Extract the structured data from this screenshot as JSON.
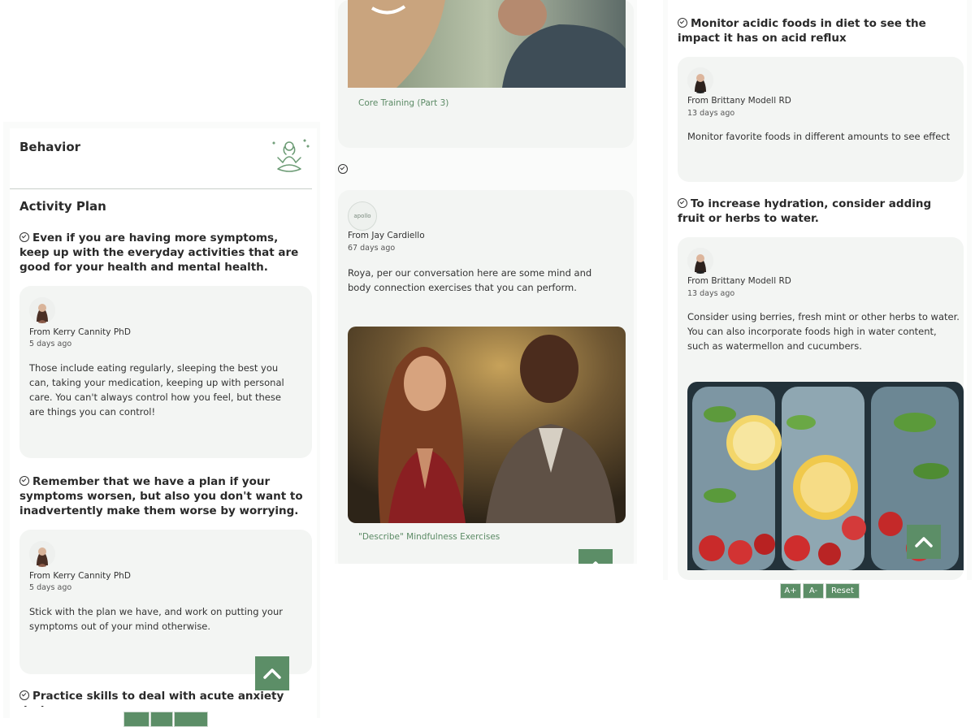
{
  "left": {
    "section_title": "Behavior",
    "plan_title": "Activity Plan",
    "tips": [
      {
        "title": "Even if you are having more symptoms, keep up with the everyday activities that are good for your health and mental health.",
        "from": "From Kerry Cannity PhD",
        "ago": "5 days ago",
        "message": "Those include eating regularly, sleeping the best you can, taking your medication, keeping up with personal care. You can't always control how you feel, but these are things you can control!"
      },
      {
        "title": "Remember that we have a plan if your symptoms worsen, but also you don't want to inadvertently make them worse by worrying.",
        "from": "From Kerry Cannity PhD",
        "ago": "5 days ago",
        "message": "Stick with the plan we have, and work on putting your symptoms out of your mind otherwise."
      },
      {
        "title": "Practice skills to deal with acute anxiety during"
      }
    ]
  },
  "middle": {
    "top_caption": "Core Training (Part 3)",
    "post": {
      "avatar_text": "apollo",
      "from": "From Jay Cardiello",
      "ago": "67 days ago",
      "message": "Roya, per our conversation here are some mind and body connection exercises that you can perform.",
      "caption": "\"Describe\" Mindfulness Exercises"
    }
  },
  "right": {
    "tips": [
      {
        "title": "Monitor acidic foods in diet to see the impact it has on acid reflux",
        "from": "From Brittany Modell RD",
        "ago": "13 days ago",
        "message": "Monitor favorite foods in different amounts to see effect"
      },
      {
        "title": "To increase hydration, consider adding fruit or herbs to water.",
        "from": "From Brittany Modell RD",
        "ago": "13 days ago",
        "message": "Consider using berries, fresh mint or other herbs to water. You can also incorporate foods high in water content, such as watermellon and cucumbers."
      }
    ],
    "font_controls": {
      "increase": "A+",
      "decrease": "A-",
      "reset": "Reset"
    }
  },
  "icons": {
    "meditation": "meditation-icon",
    "check": "check-circle-icon",
    "scroll_top": "chevron-up-icon"
  },
  "colors": {
    "accent": "#5c8e67",
    "card": "#f3f5f3"
  }
}
